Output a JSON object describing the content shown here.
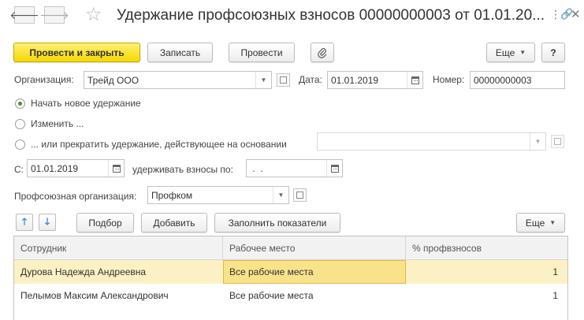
{
  "title": "Удержание профсоюзных взносов 00000000003 от 01.01.20...",
  "nav": {
    "back_icon": "arrow-left-icon",
    "forward_icon": "arrow-right-icon",
    "favorite_icon": "star-icon"
  },
  "window": {
    "menu_icon": "more-vertical-icon",
    "link_icon": "link-icon",
    "close_icon": "close-icon"
  },
  "toolbar": {
    "post_close_label": "Провести и закрыть",
    "write_label": "Записать",
    "post_label": "Провести",
    "attach_icon": "paperclip-icon",
    "more_label": "Еще",
    "help_label": "?"
  },
  "org": {
    "label": "Организация:",
    "value": "Трейд ООО"
  },
  "date": {
    "label": "Дата:",
    "value": "01.01.2019"
  },
  "number": {
    "label": "Номер:",
    "value": "00000000003"
  },
  "radios": [
    {
      "label": "Начать новое удержание",
      "checked": true
    },
    {
      "label": "Изменить ...",
      "checked": false
    },
    {
      "label": "... или прекратить удержание, действующее на основании",
      "checked": false
    }
  ],
  "basis_value": "",
  "from": {
    "label": "С:",
    "value": "01.01.2019"
  },
  "until": {
    "label": "удерживать взносы по:",
    "value": " .  ."
  },
  "union": {
    "label": "Профсоюзная организация:",
    "value": "Профком"
  },
  "table_toolbar": {
    "up_icon": "arrow-up-icon",
    "down_icon": "arrow-down-icon",
    "select_label": "Подбор",
    "add_label": "Добавить",
    "fill_label": "Заполнить показатели",
    "more_label": "Еще"
  },
  "table": {
    "columns": [
      "Сотрудник",
      "Рабочее место",
      "% профвзносов"
    ],
    "rows": [
      [
        "Дурова Надежда Андреевна",
        "Все рабочие места",
        "1"
      ],
      [
        "Пелымов Максим Александрович",
        "Все рабочие места",
        "1"
      ]
    ]
  }
}
